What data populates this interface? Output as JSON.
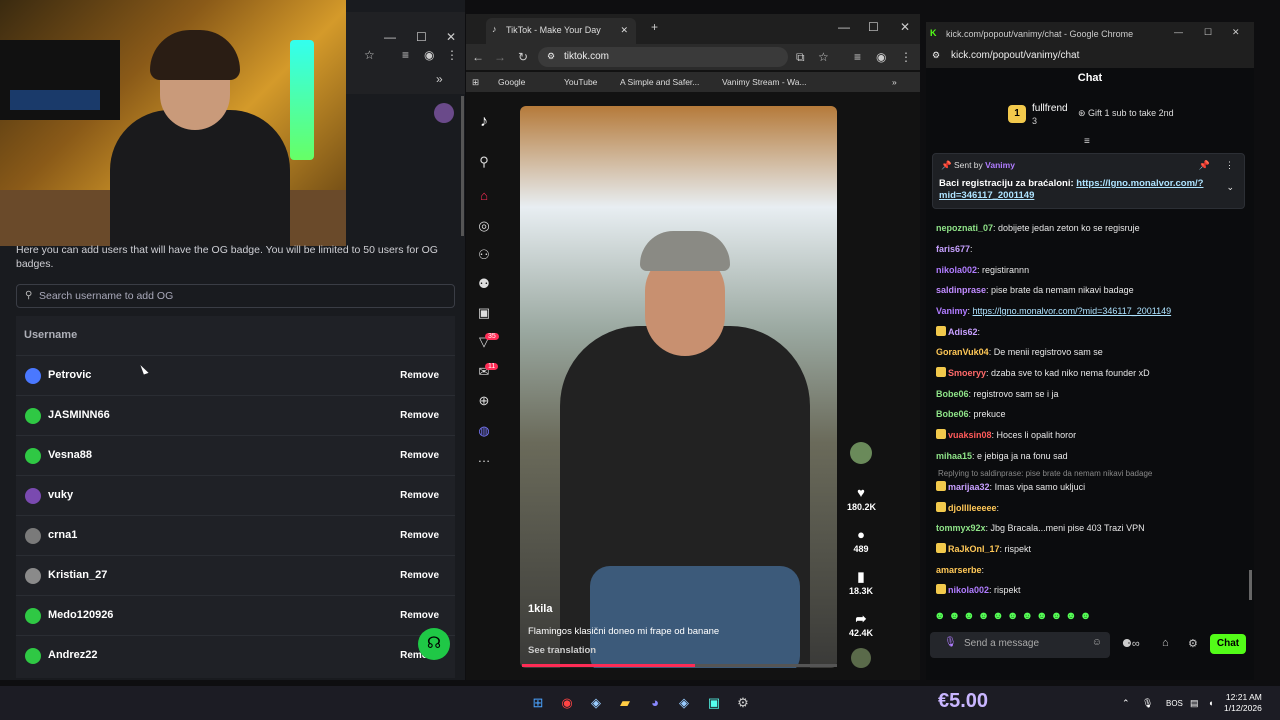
{
  "left_window": {
    "og_description": "Here you can add users that will have the OG badge. You will be limited to 50 users for OG badges.",
    "search_placeholder": "Search username to add OG",
    "column_header": "Username",
    "remove_label": "Remove",
    "users": [
      "Petrovic",
      "JASMINN66",
      "Vesna88",
      "vuky",
      "crna1",
      "Kristian_27",
      "Medo120926",
      "Andrez22"
    ]
  },
  "tiktok_window": {
    "tab_title": "TikTok - Make Your Day",
    "url": "tiktok.com",
    "bookmarks": [
      "Google",
      "YouTube",
      "A Simple and Safer...",
      "Vanimy Stream - Wa..."
    ],
    "badge_counts": [
      "35",
      "11"
    ],
    "video": {
      "author": "1kila",
      "caption": "Flamingos klasični doneo mi frape od banane",
      "see_translation": "See translation",
      "progress": 0.55
    },
    "actions": {
      "likes": "180.2K",
      "comments": "489",
      "saves": "18.3K",
      "shares": "42.4K"
    }
  },
  "kick_window": {
    "title": "kick.com/popout/vanimy/chat - Google Chrome",
    "url": "kick.com/popout/vanimy/chat",
    "chat_title": "Chat",
    "top_gifter": {
      "rank": "1",
      "name": "fullfrend",
      "count": "3"
    },
    "gift_cta": "Gift 1 sub to take 2nd",
    "pinned": {
      "sent_by_label": "Sent by",
      "sent_by_user": "Vanimy",
      "message": "Baci registraciju za braćaloni:",
      "link": "https://lgno.monalvor.com/?mid=346117_2001149"
    },
    "messages": [
      {
        "user": "nepoznati_07",
        "text": "dobijete jedan zeton ko se regisruje",
        "color": "#8fe388",
        "badge": false
      },
      {
        "user": "faris677",
        "text": "",
        "color": "#c6a0ff",
        "badge": false
      },
      {
        "user": "nikola002",
        "text": "registirannn",
        "color": "#b07cff",
        "badge": false
      },
      {
        "user": "saldinprase",
        "text": "pise brate da nemam nikavi badage",
        "color": "#c08bff",
        "badge": false
      },
      {
        "user": "Vanimy",
        "text": "https://lgno.monalvor.com/?mid=346117_2001149",
        "color": "#b07cff",
        "badge": false
      },
      {
        "user": "Adis62",
        "text": "",
        "color": "#c8a0ff",
        "badge": true
      },
      {
        "user": "GoranVuk04",
        "text": "De menii registrovo sam se",
        "color": "#ffc857",
        "badge": false
      },
      {
        "user": "Smoeryy",
        "text": "dzaba sve to kad niko nema founder xD",
        "color": "#ff6a6a",
        "badge": true
      },
      {
        "user": "Bobe06",
        "text": "registrovo sam se i ja",
        "color": "#8fe388",
        "badge": false
      },
      {
        "user": "Bobe06",
        "text": "prekuce",
        "color": "#8fe388",
        "badge": false
      },
      {
        "user": "vuaksin08",
        "text": "Hoces li opalit horor",
        "color": "#ff5a5a",
        "badge": true
      },
      {
        "user": "mihaa15",
        "text": "e jebiga ja na fonu sad",
        "color": "#8fe388",
        "badge": false
      },
      {
        "user": "marijaa32",
        "text": "Imas vipa samo ukljuci",
        "color": "#c8a0ff",
        "badge": true
      },
      {
        "user": "djolllleeeee",
        "text": "",
        "color": "#ffc857",
        "badge": true
      },
      {
        "user": "tommyx92x",
        "text": "Jbg Bracala...meni pise 403 Trazi VPN",
        "color": "#8fe388",
        "badge": false
      },
      {
        "user": "RaJkOnl_17",
        "text": "rispekt",
        "color": "#ffc857",
        "badge": true
      },
      {
        "user": "amarserbe",
        "text": "",
        "color": "#ffc857",
        "badge": false
      },
      {
        "user": "nikola002",
        "text": "rispekt",
        "color": "#b07cff",
        "badge": true
      }
    ],
    "reply_note": "Replying to saldinprase: pise brate da nemam nikavi badage",
    "input_placeholder": "Send a message",
    "send_label": "Chat"
  },
  "taskbar": {
    "price": "€5.00",
    "lang": "BOS",
    "time": "12:21 AM",
    "date": "1/12/2026"
  }
}
